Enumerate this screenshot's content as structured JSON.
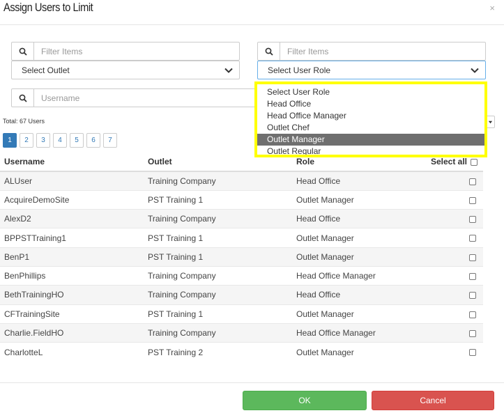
{
  "modal": {
    "title": "Assign Users to Limit",
    "close": "×"
  },
  "filters": {
    "outlet_filter_placeholder": "Filter Items",
    "outlet_select": "Select Outlet",
    "role_filter_placeholder": "Filter Items",
    "role_select": "Select User Role",
    "username_placeholder": "Username"
  },
  "total_label": "Total: 67 Users",
  "pagination": [
    "1",
    "2",
    "3",
    "4",
    "5",
    "6",
    "7"
  ],
  "table": {
    "headers": {
      "username": "Username",
      "outlet": "Outlet",
      "role": "Role",
      "select_all": "Select all"
    },
    "rows": [
      {
        "username": "ALUser",
        "outlet": "Training Company",
        "role": "Head Office"
      },
      {
        "username": "AcquireDemoSite",
        "outlet": "PST Training 1",
        "role": "Outlet Manager"
      },
      {
        "username": "AlexD2",
        "outlet": "Training Company",
        "role": "Head Office"
      },
      {
        "username": "BPPSTTraining1",
        "outlet": "PST Training 1",
        "role": "Outlet Manager"
      },
      {
        "username": "BenP1",
        "outlet": "PST Training 1",
        "role": "Outlet Manager"
      },
      {
        "username": "BenPhillips",
        "outlet": "Training Company",
        "role": "Head Office Manager"
      },
      {
        "username": "BethTrainingHO",
        "outlet": "Training Company",
        "role": "Head Office"
      },
      {
        "username": "CFTrainingSite",
        "outlet": "PST Training 1",
        "role": "Outlet Manager"
      },
      {
        "username": "Charlie.FieldHO",
        "outlet": "Training Company",
        "role": "Head Office Manager"
      },
      {
        "username": "CharlotteL",
        "outlet": "PST Training 2",
        "role": "Outlet Manager"
      }
    ]
  },
  "role_dropdown": {
    "options": [
      "Select User Role",
      "Head Office",
      "Head Office Manager",
      "Outlet Chef",
      "Outlet Manager",
      "Outlet Regular"
    ],
    "highlighted": "Outlet Manager"
  },
  "buttons": {
    "ok": "OK",
    "cancel": "Cancel"
  },
  "colors": {
    "ok": "#5cb85c",
    "cancel": "#d9534f",
    "highlight_border": "#ffff00",
    "pager_active": "#337ab7"
  }
}
